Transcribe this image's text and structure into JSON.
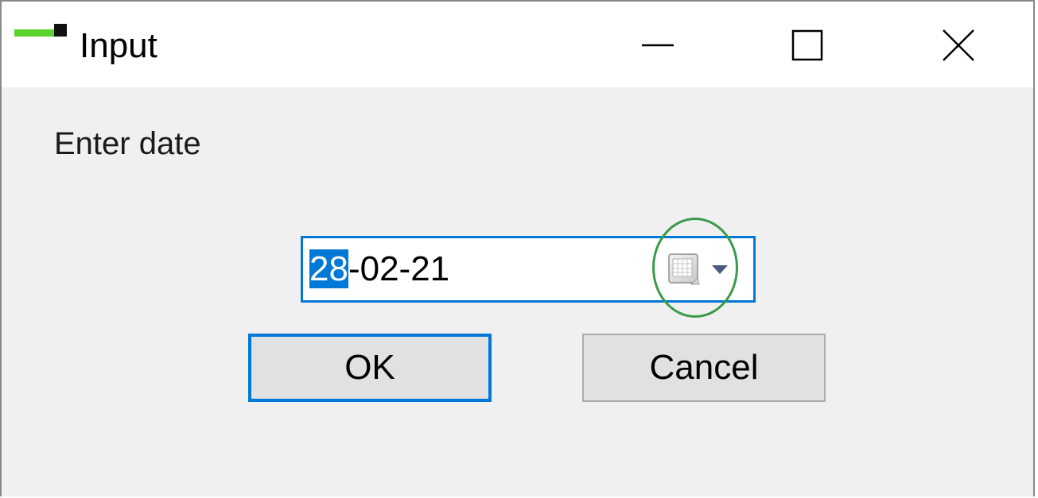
{
  "window": {
    "title": "Input",
    "icon": "app-icon",
    "controls": {
      "minimize_icon": "minimize-icon",
      "maximize_icon": "maximize-icon",
      "close_icon": "close-icon"
    }
  },
  "dialog": {
    "prompt": "Enter date",
    "date_picker": {
      "selected_part": "28",
      "rest": "-02-21",
      "dropdown_icon": "calendar-dropdown-icon"
    },
    "ok_label": "OK",
    "cancel_label": "Cancel"
  },
  "colors": {
    "accent": "#0078d7",
    "highlight_circle": "#3a9a4a",
    "app_icon_green": "#5bd32a"
  }
}
